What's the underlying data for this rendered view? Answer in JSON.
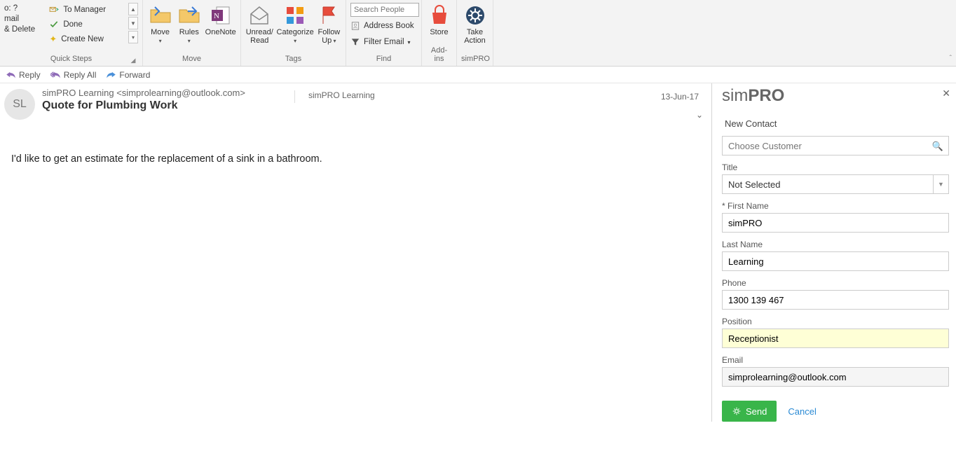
{
  "ribbon": {
    "quick_steps": {
      "left": [
        "o: ?",
        "mail",
        "& Delete"
      ],
      "items": [
        {
          "icon": "to-manager",
          "label": "To Manager"
        },
        {
          "icon": "done",
          "label": "Done"
        },
        {
          "icon": "create-new",
          "label": "Create New"
        }
      ],
      "group_label": "Quick Steps"
    },
    "move": {
      "move_btn": "Move",
      "rules_btn": "Rules",
      "onenote_btn": "OneNote",
      "group_label": "Move"
    },
    "tags": {
      "unread_read": "Unread/\nRead",
      "categorize": "Categorize",
      "follow_up": "Follow\nUp",
      "group_label": "Tags"
    },
    "find": {
      "search_placeholder": "Search People",
      "address_book": "Address Book",
      "filter_email": "Filter Email",
      "group_label": "Find"
    },
    "addins": {
      "store": "Store",
      "group_label": "Add-ins"
    },
    "simpro": {
      "take_action": "Take\nAction",
      "group_label": "simPRO"
    }
  },
  "actions": {
    "reply": "Reply",
    "reply_all": "Reply All",
    "forward": "Forward"
  },
  "message": {
    "avatar_initials": "SL",
    "from": "simPRO Learning <simprolearning@outlook.com>",
    "account": "simPRO Learning",
    "date": "13-Jun-17",
    "subject": "Quote for Plumbing Work",
    "body": "I'd like to get an estimate for the replacement of a sink in a bathroom."
  },
  "panel": {
    "title_light": "sim",
    "title_bold": "PRO",
    "section": "New Contact",
    "customer_placeholder": "Choose Customer",
    "title_label": "Title",
    "title_value": "Not Selected",
    "first_name_label": "* First Name",
    "first_name_value": "simPRO",
    "last_name_label": "Last Name",
    "last_name_value": "Learning",
    "phone_label": "Phone",
    "phone_value": "1300 139 467",
    "position_label": "Position",
    "position_value": "Receptionist",
    "email_label": "Email",
    "email_value": "simprolearning@outlook.com",
    "send": "Send",
    "cancel": "Cancel"
  }
}
